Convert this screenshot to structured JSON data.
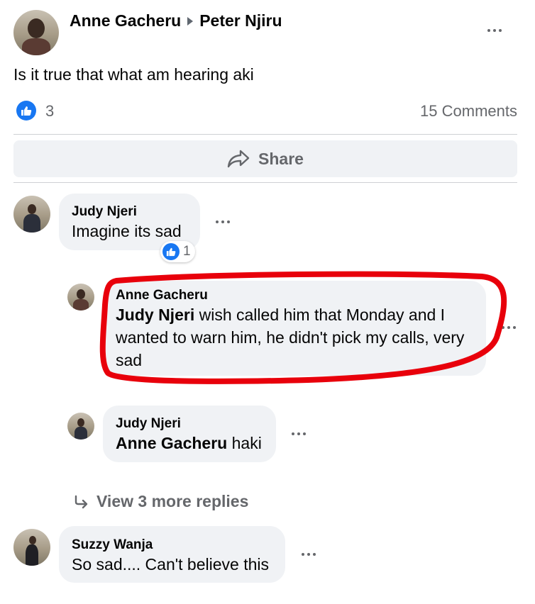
{
  "post": {
    "author": "Anne Gacheru",
    "recipient": "Peter Njiru",
    "text": "Is it true that what am hearing aki",
    "like_count": "3",
    "comments_count": "15 Comments",
    "share_label": "Share"
  },
  "comments": [
    {
      "name": "Judy Njeri",
      "text": "Imagine its sad",
      "reaction_count": "1"
    },
    {
      "name": "Anne Gacheru",
      "mention": "Judy Njeri",
      "text": " wish called him that Monday and I wanted to warn him, he didn't pick my calls, very sad"
    },
    {
      "name": "Judy Njeri",
      "mention": "Anne Gacheru",
      "text": " haki"
    },
    {
      "name": "Suzzy Wanja",
      "text": "So sad.... Can't believe this"
    }
  ],
  "view_more_replies": "View 3 more replies",
  "colors": {
    "accent": "#1877f2",
    "bubble": "#f0f2f5",
    "highlight": "#e8000b",
    "secondary_text": "#65676b"
  }
}
